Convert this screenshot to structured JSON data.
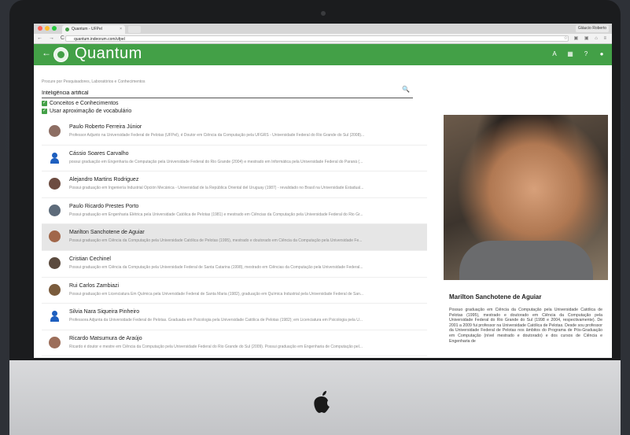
{
  "browser": {
    "tab_title": "Quantum - UFPel",
    "tab_close": "×",
    "user_name": "Gláucio Roberto",
    "url": "quantum.indeorum.com/ufpel",
    "nav_glyphs": "← → C",
    "url_icons": "☆ ▣ ▣ ⌂ ≡",
    "dot_colors": [
      "#ff5f57",
      "#ffbd2e",
      "#28c940"
    ]
  },
  "app": {
    "title": "Quantum",
    "back_glyph": "←",
    "accent": "#43a047",
    "header_icons": [
      "A",
      "▦",
      "?",
      "●"
    ]
  },
  "search": {
    "hint": "Procure por Pesquisadores, Laboratórios e Conhecimentos",
    "value": "Inteligência artifical",
    "icon_glyph": "🔍"
  },
  "filters": [
    {
      "label": "Conceitos e Conhecimentos",
      "checked": true
    },
    {
      "label": "Usar aproximação de vocabulário",
      "checked": true
    }
  ],
  "results": [
    {
      "name": "Paulo Roberto Ferreira Júnior",
      "desc": "Professor Adjunto na Universidade Federal de Pelotas (UFPel), é Doutor em Ciência da Computação pela UFGRS - Universidade Federal do Rio Grande do Sul (2008)..."
    },
    {
      "name": "Cássio Soares Carvalho",
      "desc": "possui graduação em Engenharia de Computação pela Universidade Federal do Rio Grande (2004) e mestrado em Informática pela Universidade Federal do Paraná (..."
    },
    {
      "name": "Alejandro Martins Rodriguez",
      "desc": "Possui graduação em Ingeniería Industrial Opción Mecánica - Universidad de la República Oriental del Uruguay (1987) - revalidado no Brasil na Universidade Estadual..."
    },
    {
      "name": "Paulo Ricardo Prestes Porto",
      "desc": "Possui graduação em Engenharia Elétrica pela Universidade Católica de Pelotas (1981) e mestrado em Ciências da Computação pela Universidade Federal do Rio Gr..."
    },
    {
      "name": "Marilton Sanchotene de Aguiar",
      "desc": "Possui graduação em Ciência da Computação pela Universidade Católica de Pelotas (1995), mestrado e doutorado em Ciência da Computação pela Universidade Fe..."
    },
    {
      "name": "Cristian Cechinel",
      "desc": "Possui graduação em Ciência da Computação pela Universidade Federal de Santa Catarina (1998), mestrado em Ciências da Computação pela Universidade Federal..."
    },
    {
      "name": "Rui Carlos Zambiazi",
      "desc": "Possui graduação em Licenciatura Em Química pela Universidade Federal de Santa Maria (1982), graduação em Química Industrial pela Universidade Federal de San..."
    },
    {
      "name": "Silvia Nara Siqueira Pinheiro",
      "desc": "Professora Adjunta da Universidade Federal de Pelotas. Graduada em Psicologia pela Universidade Católica de Pelotas (1982); em Licenciatura em Psicologia pela U..."
    },
    {
      "name": "Ricardo Matsumura de Araújo",
      "desc": "Ricardo é doutor e mestre em Ciência da Computação pela Universidade Federal do Rio Grande do Sul (2009). Possui graduação em Engenharia de Computação pel..."
    }
  ],
  "detail": {
    "name": "Marilton Sanchotene de Aguiar",
    "bio": "Possuo graduação em Ciência da Computação pela Universidade Católica de Pelotas (1995), mestrado e doutorado em Ciência da Computação pela Universidade Federal do Rio Grande do Sul (1998 e 2004, respectivamente). De 2001 a 2009 fui professor na Universidade Católica de Pelotas. Desde sou professor da Universidade Federal de Pelotas nos âmbitos do Programa de Pós-Graduação em Computação (nível mestrado e doutorado) e dos cursos de Ciência e Engenharia de"
  }
}
